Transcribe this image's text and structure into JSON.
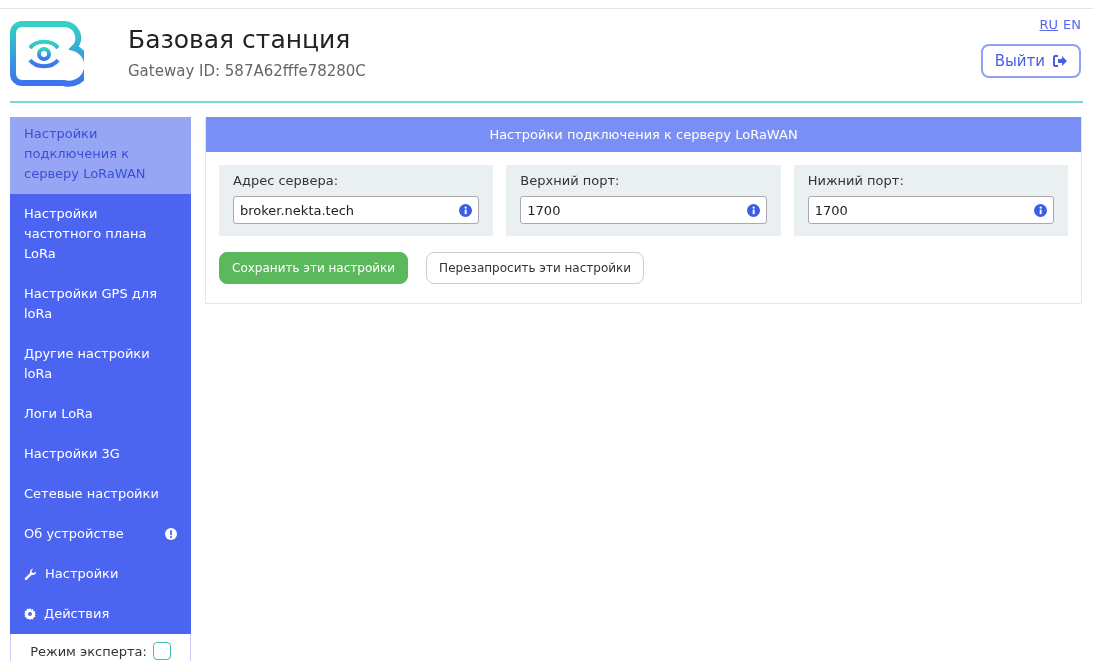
{
  "header": {
    "title": "Базовая станция",
    "subtitle": "Gateway ID: 587A62fffe78280C",
    "languages": [
      {
        "label": "RU",
        "selected": true
      },
      {
        "label": "EN",
        "selected": false
      }
    ],
    "logout": "Выйти"
  },
  "sidebar": {
    "items": [
      {
        "label": "Настройки подключения к серверу LoRaWAN",
        "selected": true,
        "kind": "text"
      },
      {
        "label": "Настройки частотного плана LoRa",
        "selected": false,
        "kind": "text"
      },
      {
        "label": "Настройки GPS для loRa",
        "selected": false,
        "kind": "text"
      },
      {
        "label": "Другие настройки loRa",
        "selected": false,
        "kind": "text"
      },
      {
        "label": "Логи LoRa",
        "selected": false,
        "kind": "text"
      },
      {
        "label": "Настройки 3G",
        "selected": false,
        "kind": "text"
      },
      {
        "label": "Сетевые настройки",
        "selected": false,
        "kind": "text"
      },
      {
        "label": "Об устройстве",
        "selected": false,
        "kind": "alert"
      },
      {
        "label": "Настройки",
        "selected": false,
        "kind": "wrench"
      },
      {
        "label": "Действия",
        "selected": false,
        "kind": "gear"
      }
    ],
    "expert_mode": {
      "label": "Режим эксперта:",
      "checked": false
    }
  },
  "panel": {
    "title": "Настройки подключения к серверу LoRaWAN",
    "fields": [
      {
        "label": "Адрес сервера:",
        "value": "broker.nekta.tech"
      },
      {
        "label": "Верхний порт:",
        "value": "1700"
      },
      {
        "label": "Нижний порт:",
        "value": "1700"
      }
    ],
    "buttons": [
      {
        "label": "Сохранить эти настройки",
        "kind": "primary"
      },
      {
        "label": "Перезапросить эти настройки",
        "kind": "secondary"
      }
    ]
  }
}
